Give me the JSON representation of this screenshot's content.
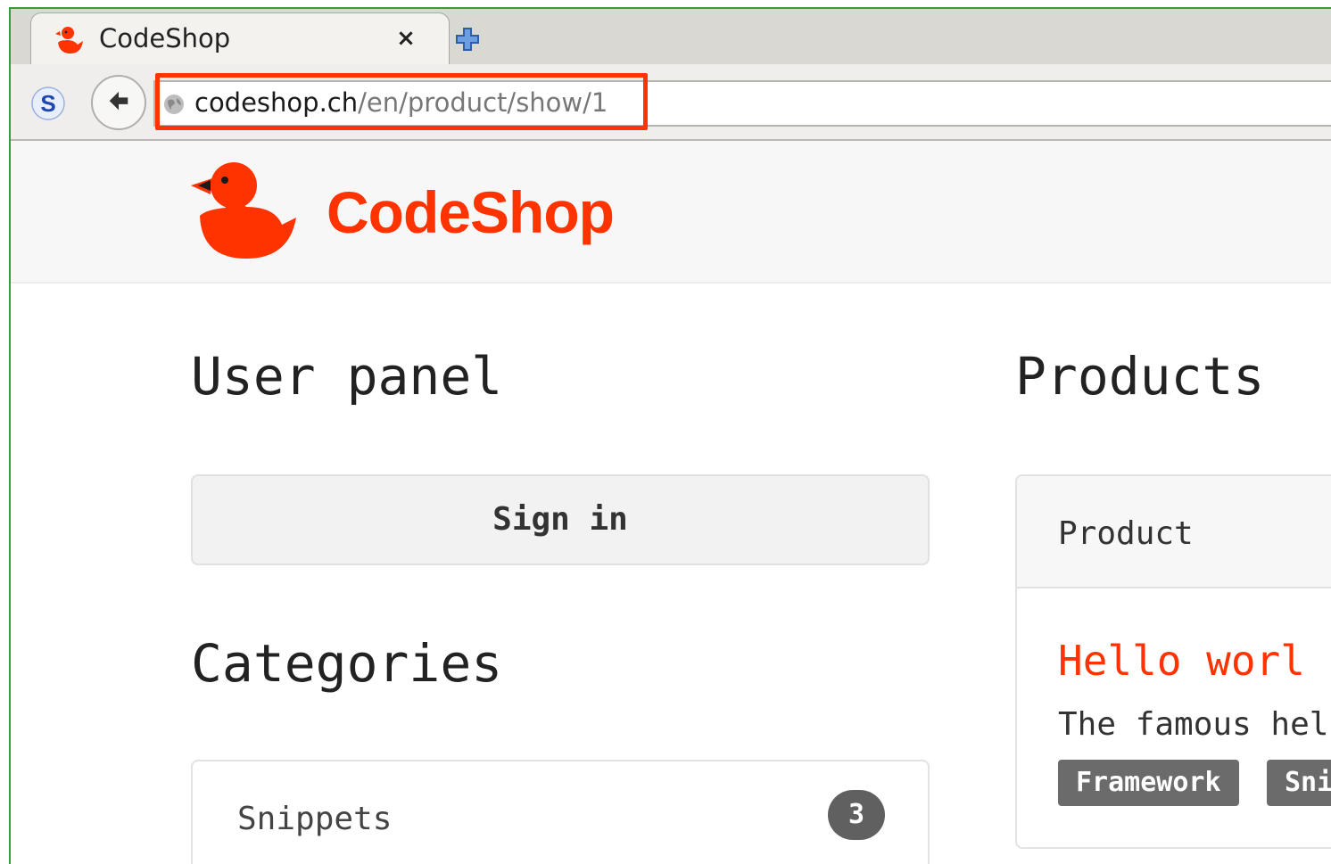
{
  "browser": {
    "tab_title": "CodeShop",
    "tab_close": "×",
    "url_host": "codeshop.ch",
    "url_path": "/en/product/show/1"
  },
  "site": {
    "logo_text": "CodeShop",
    "brand_color": "#ff3300"
  },
  "user_panel": {
    "heading": "User panel",
    "sign_in_label": "Sign in"
  },
  "categories": {
    "heading": "Categories",
    "items": [
      {
        "label": "Snippets",
        "count": "3"
      }
    ]
  },
  "products": {
    "heading": "Products",
    "card_header": "Product",
    "name": "Hello worl",
    "description": "The famous hel",
    "tags": [
      "Framework",
      "Sni"
    ]
  }
}
